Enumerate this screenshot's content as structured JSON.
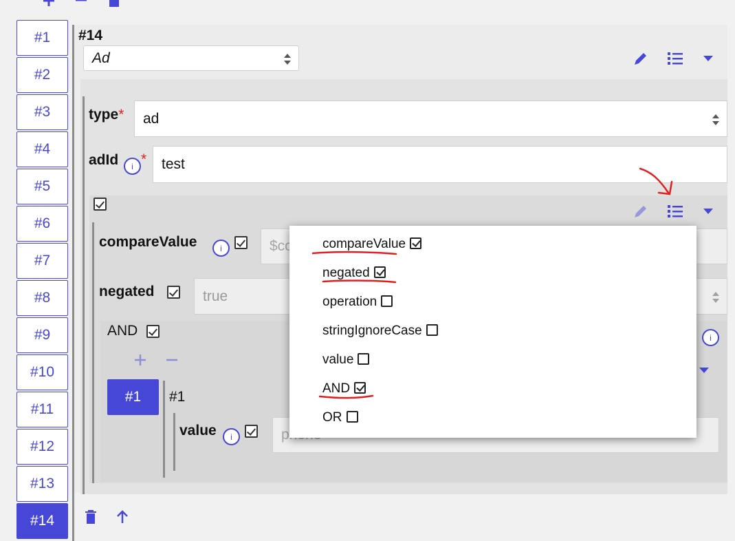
{
  "toolbar": {
    "add_icon": "plus-icon",
    "remove_icon": "minus-icon",
    "delete_icon": "trash-icon"
  },
  "nav": {
    "items": [
      "#1",
      "#2",
      "#3",
      "#4",
      "#5",
      "#6",
      "#7",
      "#8",
      "#9",
      "#10",
      "#11",
      "#12",
      "#13",
      "#14"
    ],
    "active": "#14"
  },
  "item": {
    "title": "#14",
    "type_select": "Ad",
    "type_label": "type",
    "type_value": "ad",
    "adid_label": "adId",
    "adid_value": "test",
    "compare_label": "compareValue",
    "compare_placeholder": "$co",
    "negated_label": "negated",
    "negated_value": "true",
    "and_label": "AND",
    "sub_nav": "#1",
    "sub_title": "#1",
    "value_label": "value",
    "value_placeholder": "phone",
    "required_mark": "*",
    "info_mark": "i"
  },
  "menu": {
    "items": [
      {
        "label": "compareValue",
        "checked": true
      },
      {
        "label": "negated",
        "checked": true
      },
      {
        "label": "operation",
        "checked": false
      },
      {
        "label": "stringIgnoreCase",
        "checked": false
      },
      {
        "label": "value",
        "checked": false
      },
      {
        "label": "AND",
        "checked": true
      },
      {
        "label": "OR",
        "checked": false
      }
    ]
  },
  "colors": {
    "accent": "#4747d7",
    "annotation": "#e02020",
    "panel": "#e6e6e6"
  }
}
